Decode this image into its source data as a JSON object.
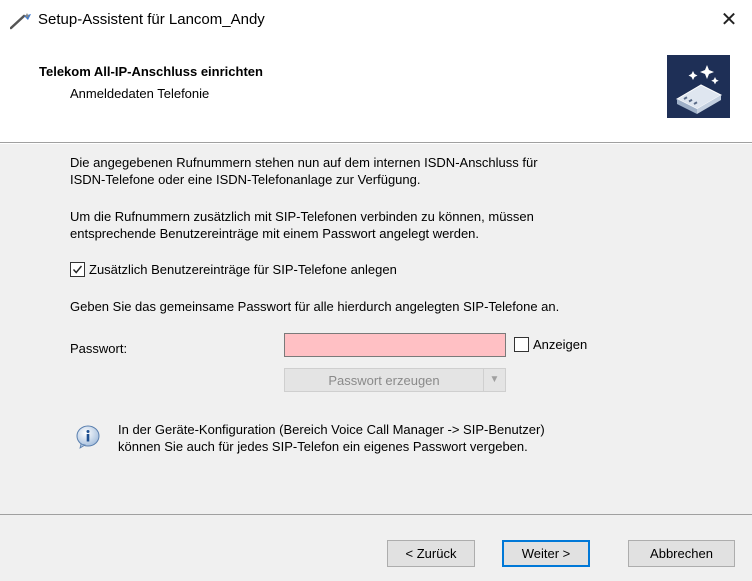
{
  "window": {
    "title": "Setup-Assistent für Lancom_Andy",
    "close_glyph": "✕"
  },
  "header": {
    "title": "Telekom All-IP-Anschluss einrichten",
    "subtitle": "Anmeldedaten Telefonie",
    "logo_icon": "wizard-device-icon"
  },
  "content": {
    "para1": [
      "Die angegebenen Rufnummern stehen nun auf dem internen ISDN-Anschluss für",
      "ISDN-Telefone oder eine ISDN-Telefonanlage zur Verfügung."
    ],
    "para2": [
      "Um die Rufnummern zusätzlich mit SIP-Telefonen verbinden zu können, müssen",
      "entsprechende Benutzereinträge mit einem Passwort angelegt werden."
    ],
    "checkbox_sip": {
      "label": "Zusätzlich Benutzereinträge für SIP-Telefone anlegen",
      "checked": true
    },
    "para3": "Geben Sie das gemeinsame Passwort für alle hierdurch angelegten SIP-Telefone an.",
    "password": {
      "label": "Passwort:",
      "value": "",
      "background_color": "#ffc0c4"
    },
    "show_checkbox": {
      "label": "Anzeigen",
      "checked": false
    },
    "generate_button": {
      "label": "Passwort erzeugen",
      "disabled": true,
      "dropdown_icon": "chevron-down-icon"
    },
    "info": {
      "icon": "info-icon",
      "text": [
        "In der Geräte-Konfiguration (Bereich Voice Call Manager -> SIP-Benutzer)",
        "können Sie auch für jedes SIP-Telefon ein eigenes Passwort vergeben."
      ]
    }
  },
  "footer": {
    "back_label": "< Zurück",
    "next_label": "Weiter >",
    "cancel_label": "Abbrechen"
  },
  "colors": {
    "accent": "#0078d7",
    "content_bg": "#f0f0f0",
    "logo_bg": "#1e2f56"
  }
}
